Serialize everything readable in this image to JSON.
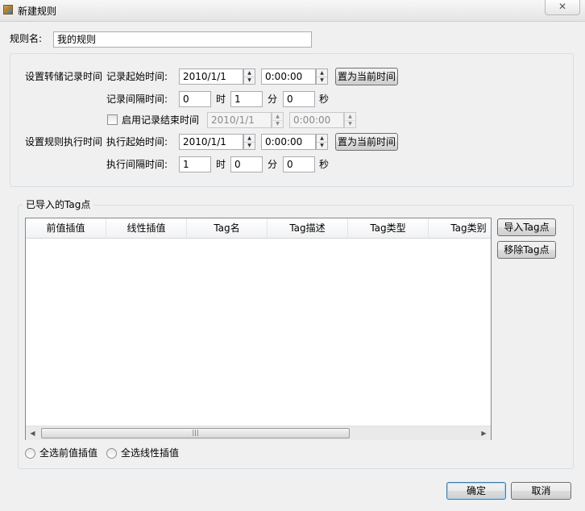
{
  "window": {
    "title": "新建规则",
    "close_glyph": "✕"
  },
  "rule_name": {
    "label": "规则名:",
    "value": "我的规则"
  },
  "record_section": {
    "heading": "设置转储记录时间",
    "start_label": "记录起始时间:",
    "start_date": "2010/1/1",
    "start_time": "0:00:00",
    "set_now_button": "置为当前时间",
    "interval_label": "记录间隔时间:",
    "interval_hours": "0",
    "hours_unit": "时",
    "interval_minutes": "1",
    "minutes_unit": "分",
    "interval_seconds": "0",
    "seconds_unit": "秒",
    "enable_end_label": "启用记录结束时间",
    "end_date": "2010/1/1",
    "end_time": "0:00:00"
  },
  "exec_section": {
    "heading": "设置规则执行时间",
    "start_label": "执行起始时间:",
    "start_date": "2010/1/1",
    "start_time": "0:00:00",
    "set_now_button": "置为当前时间",
    "interval_label": "执行间隔时间:",
    "interval_hours": "1",
    "hours_unit": "时",
    "interval_minutes": "0",
    "minutes_unit": "分",
    "interval_seconds": "0",
    "seconds_unit": "秒"
  },
  "tags": {
    "group_title": "已导入的Tag点",
    "columns": [
      "前值插值",
      "线性插值",
      "Tag名",
      "Tag描述",
      "Tag类型",
      "Tag类别"
    ],
    "rows": [],
    "import_button": "导入Tag点",
    "remove_button": "移除Tag点",
    "scroll_left": "◀",
    "scroll_right": "▶",
    "scroll_grip": "|||"
  },
  "options": {
    "select_all_previous": "全选前值插值",
    "select_all_linear": "全选线性插值"
  },
  "footer": {
    "ok_button": "确定",
    "cancel_button": "取消"
  }
}
